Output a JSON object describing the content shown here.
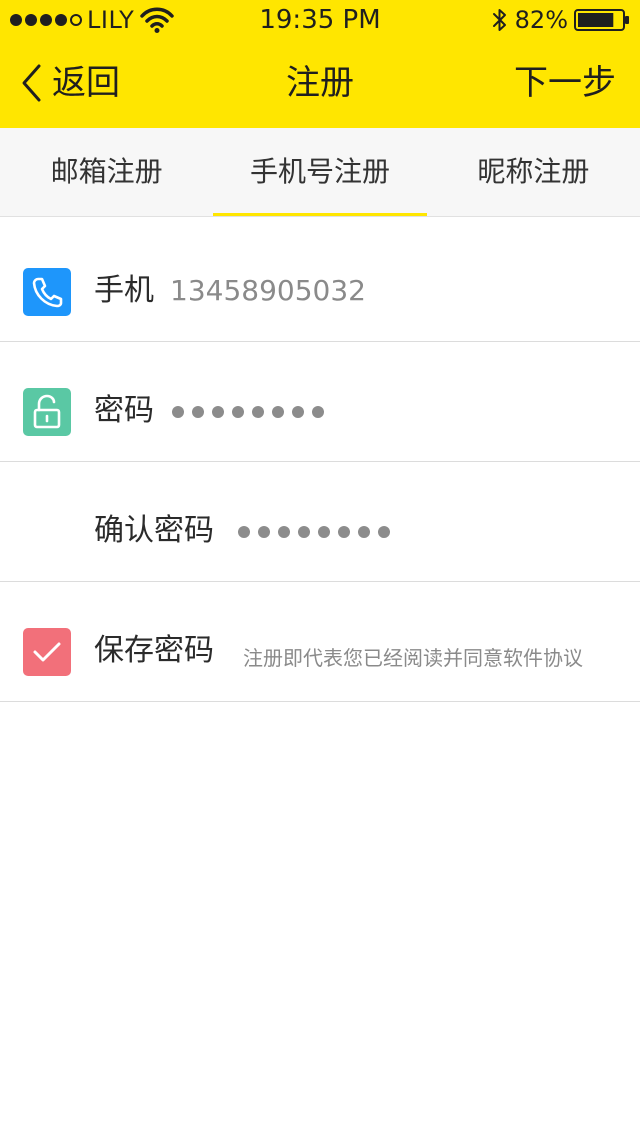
{
  "status_bar": {
    "carrier": "LILY",
    "time": "19:35  PM",
    "battery_percent": "82%",
    "battery_level": 0.82,
    "icons": [
      "signal-dots",
      "wifi-icon",
      "bluetooth-icon",
      "battery-icon"
    ]
  },
  "nav": {
    "back_label": "返回",
    "title": "注册",
    "next_label": "下一步",
    "background_color": "#ffe600"
  },
  "tabs": [
    {
      "label": "邮箱注册",
      "active": false
    },
    {
      "label": "手机号注册",
      "active": true
    },
    {
      "label": "昵称注册",
      "active": false
    }
  ],
  "form": {
    "phone": {
      "label": "手机",
      "value": "13458905032",
      "icon": "phone-icon",
      "icon_color": "#1e96fb"
    },
    "password": {
      "label": "密码",
      "masked_length": 8,
      "icon": "unlock-icon",
      "icon_color": "#5ac8a4"
    },
    "confirm_password": {
      "label": "确认密码",
      "masked_length": 8
    },
    "save_password": {
      "label": "保存密码",
      "checked": true,
      "icon": "checkbox-checked-icon",
      "icon_color": "#f2707a",
      "agreement_text": "注册即代表您已经阅读并同意软件协议"
    }
  }
}
